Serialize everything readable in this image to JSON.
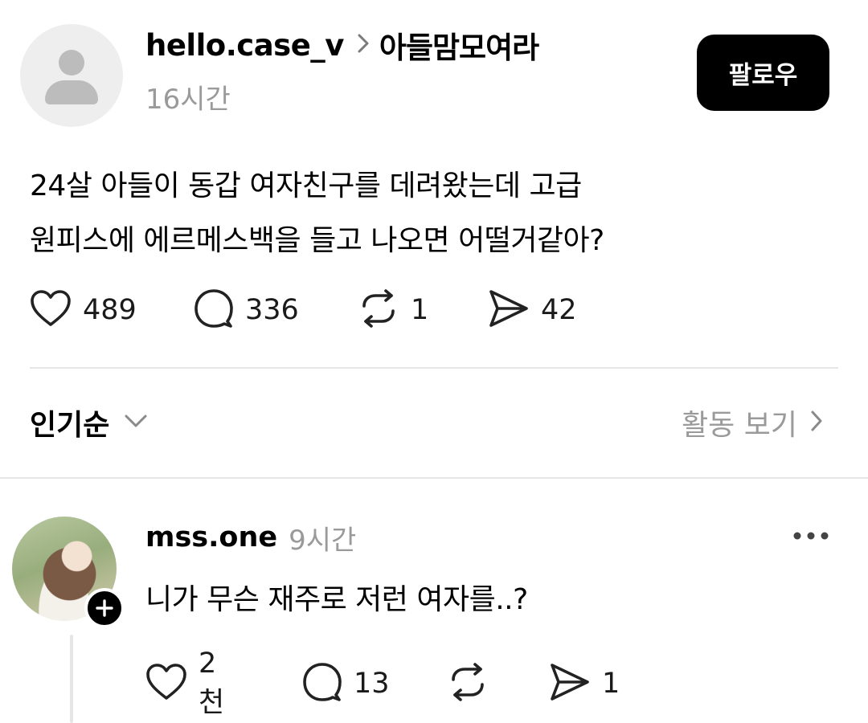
{
  "post": {
    "username": "hello.case_v",
    "community": "아들맘모여라",
    "time": "16시간",
    "follow_label": "팔로우",
    "text_lines": [
      "24살 아들이 동갑 여자친구를 데려왔는데 고급",
      "원피스에 에르메스백을 들고 나오면 어떨거같아?"
    ],
    "stats": {
      "likes": "489",
      "comments": "336",
      "reposts": "1",
      "shares": "42"
    }
  },
  "sort": {
    "label": "인기순",
    "activity_label": "활동 보기"
  },
  "comment": {
    "username": "mss.one",
    "time": "9시간",
    "text": "니가 무슨 재주로 저런 여자를..?",
    "stats": {
      "likes": "2천",
      "comments": "13",
      "shares": "1"
    }
  }
}
